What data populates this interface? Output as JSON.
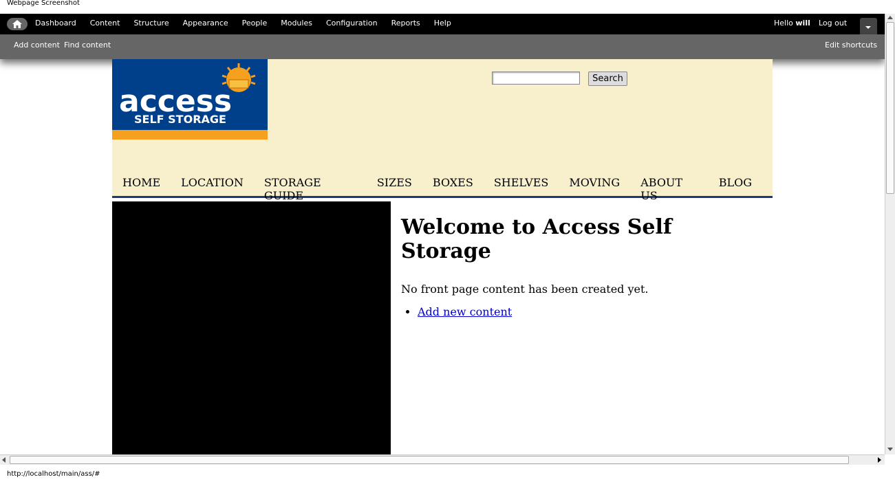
{
  "window": {
    "title": "Webpage Screenshot"
  },
  "toolbar": {
    "menu": [
      "Dashboard",
      "Content",
      "Structure",
      "Appearance",
      "People",
      "Modules",
      "Configuration",
      "Reports",
      "Help"
    ],
    "greeting": "Hello ",
    "username": "will",
    "logout": "Log out",
    "shortcuts": [
      "Add content",
      "Find content"
    ],
    "edit_shortcuts": "Edit shortcuts"
  },
  "logo": {
    "word": "access",
    "tagline": "SELF STORAGE"
  },
  "search": {
    "value": "",
    "button": "Search"
  },
  "nav": [
    "HOME",
    "LOCATION",
    "STORAGE GUIDE",
    "SIZES",
    "BOXES",
    "SHELVES",
    "MOVING",
    "ABOUT US",
    "BLOG"
  ],
  "main": {
    "title": "Welcome to Access Self Storage",
    "message": "No front page content has been created yet.",
    "links": [
      "Add new content"
    ]
  },
  "status_bar": {
    "url": "http://localhost/main/ass/#"
  },
  "colors": {
    "header_bg": "#f8f0cd",
    "logo_blue": "#003f8a",
    "logo_orange": "#f5a01f",
    "nav_rule": "#1a3a7a",
    "link": "#0000cc"
  }
}
